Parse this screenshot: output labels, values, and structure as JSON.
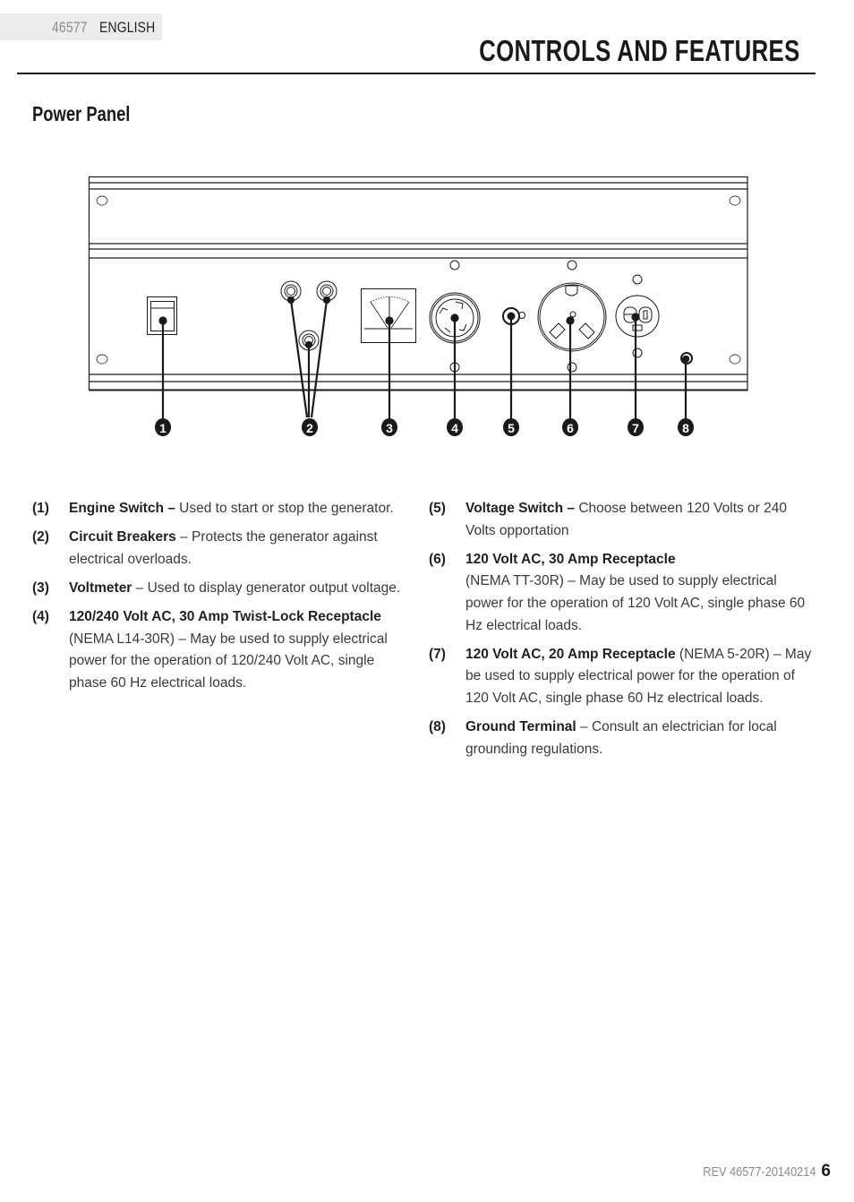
{
  "header": {
    "model_code": "46577",
    "language": "ENGLISH",
    "title": "CONTROLS AND FEATURES"
  },
  "section": {
    "title": "Power Panel"
  },
  "diagram": {
    "callouts": [
      "1",
      "2",
      "3",
      "4",
      "5",
      "6",
      "7",
      "8"
    ],
    "components": [
      {
        "id": 1,
        "icon": "engine-switch-icon"
      },
      {
        "id": 2,
        "icon": "circuit-breaker-icon"
      },
      {
        "id": 3,
        "icon": "voltmeter-icon"
      },
      {
        "id": 4,
        "icon": "twist-lock-receptacle-icon"
      },
      {
        "id": 5,
        "icon": "voltage-switch-icon"
      },
      {
        "id": 6,
        "icon": "tt30-receptacle-icon"
      },
      {
        "id": 7,
        "icon": "duplex-receptacle-icon"
      },
      {
        "id": 8,
        "icon": "ground-terminal-icon"
      }
    ]
  },
  "features": {
    "left": [
      {
        "num": "(1)",
        "name": "Engine Switch –",
        "desc": " Used to start or stop the generator."
      },
      {
        "num": "(2)",
        "name": "Circuit Breakers",
        "desc": " – Protects the generator against electrical overloads."
      },
      {
        "num": "(3)",
        "name": "Voltmeter",
        "desc": " – Used to display generator output voltage."
      },
      {
        "num": "(4)",
        "name": "120/240 Volt AC, 30 Amp Twist-Lock Receptacle",
        "desc": " (NEMA L14-30R) – May be used to supply electrical power for the operation of 120/240 Volt AC, single phase 60 Hz electrical loads."
      }
    ],
    "right": [
      {
        "num": "(5)",
        "name": "Voltage Switch –",
        "desc": " Choose between 120 Volts or 240 Volts opportation"
      },
      {
        "num": "(6)",
        "name": "120 Volt AC, 30 Amp Receptacle",
        "desc": " (NEMA TT-30R) – May be used to supply electrical power for the operation of 120 Volt AC, single phase 60 Hz electrical loads."
      },
      {
        "num": "(7)",
        "name": "120 Volt AC, 20 Amp Receptacle",
        "desc": " (NEMA 5-20R) – May be used to supply electrical power for the operation of 120 Volt AC, single phase 60 Hz electrical loads."
      },
      {
        "num": "(8)",
        "name": "Ground Terminal",
        "desc": " – Consult an electrician for local grounding regulations."
      }
    ]
  },
  "footer": {
    "revision": "REV 46577-20140214",
    "page_number": "6"
  }
}
